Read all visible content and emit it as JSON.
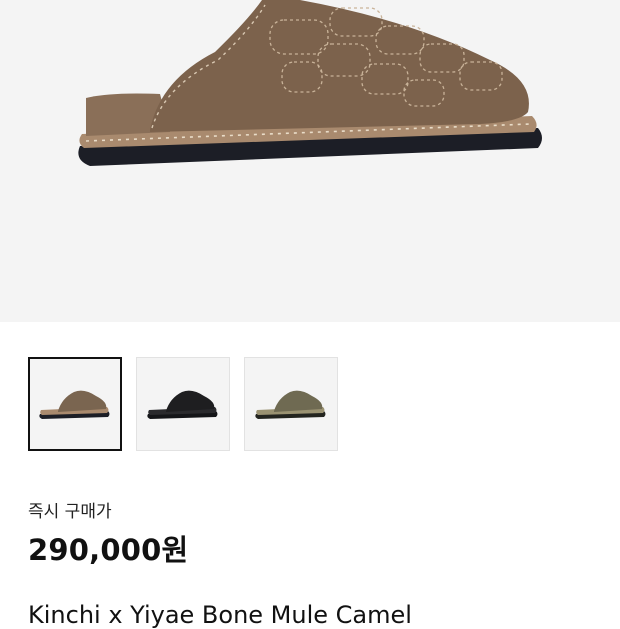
{
  "product": {
    "images": [
      {
        "name": "camel",
        "color": "#7a6550",
        "selected": true
      },
      {
        "name": "black",
        "color": "#1e1e20",
        "selected": false
      },
      {
        "name": "olive",
        "color": "#6f6a52",
        "selected": false
      }
    ],
    "price_label": "즉시 구매가",
    "price": "290,000원",
    "title": "Kinchi x Yiyae Bone Mule Camel"
  }
}
